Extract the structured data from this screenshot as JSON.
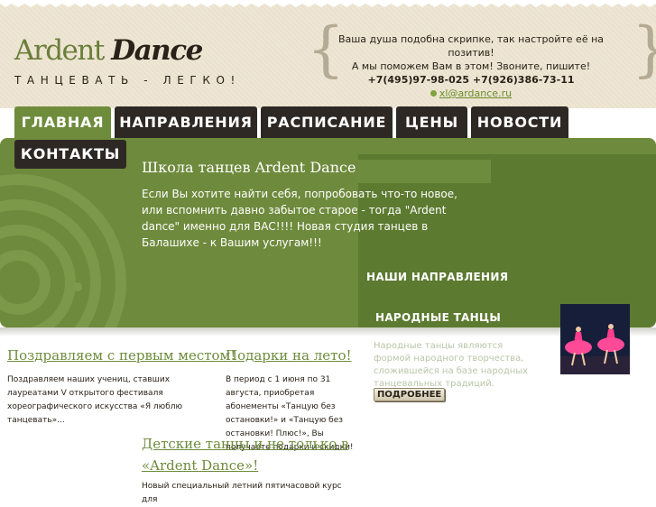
{
  "header": {
    "logo": {
      "part1": "Ardent",
      "part2": "Dance"
    },
    "tagline": "ТАНЦЕВАТЬ - ЛЕГКО!",
    "contact": {
      "line1": "Ваша душа подобна скрипке, так настройте её на позитив!",
      "line2": "А мы поможем Вам в этом! Звоните, пишите!",
      "phones": "+7(495)97-98-025 +7(926)386-73-11",
      "email": "xl@ardance.ru"
    }
  },
  "nav": {
    "items": [
      {
        "label": "ГЛАВНАЯ"
      },
      {
        "label": "НАПРАВЛЕНИЯ"
      },
      {
        "label": "РАСПИСАНИЕ"
      },
      {
        "label": "ЦЕНЫ"
      },
      {
        "label": "НОВОСТИ"
      },
      {
        "label": "КОНТАКТЫ"
      }
    ]
  },
  "banner": {
    "title": "Школа танцев Ardent Dance",
    "text": "Если Вы хотите найти себя, попробовать что-то новое, или вспомнить давно забытое старое - тогда \"Ardent dance\" именно для ВАС!!!! Новая студия танцев в Балашихе - к Вашим услугам!!!"
  },
  "directions": {
    "heading": "НАШИ НАПРАВЛЕНИЯ",
    "item_title": "НАРОДНЫЕ ТАНЦЫ",
    "item_text": "Народные танцы являются формой народного творчества, сложившейся на базе народных танцевальных традиций.",
    "more_label": "ПОДРОБНЕЕ"
  },
  "news": [
    {
      "title": "Поздравляем с первым местом!",
      "text": "Поздравляем наших учениц, ставших лауреатами V открытого фестиваля хореографического искусства «Я люблю танцевать»..."
    },
    {
      "title": "Подарки на лето!",
      "text": "В период с 1 июня по 31 августа, приобретая абонементы «Танцую без остановки!» и «Танцую без остановки! Плюс!», Вы получаете подарки и скидки!"
    },
    {
      "title": "Детские танцы и не только в «Ardent Dance»!",
      "text": "Новый специальный летний пятичасовой курс для"
    }
  ],
  "colors": {
    "accent_green": "#6e8c3c",
    "nav_dark": "#2e2824",
    "header_bg": "#efe6d4",
    "text_dark": "#2a2218"
  }
}
